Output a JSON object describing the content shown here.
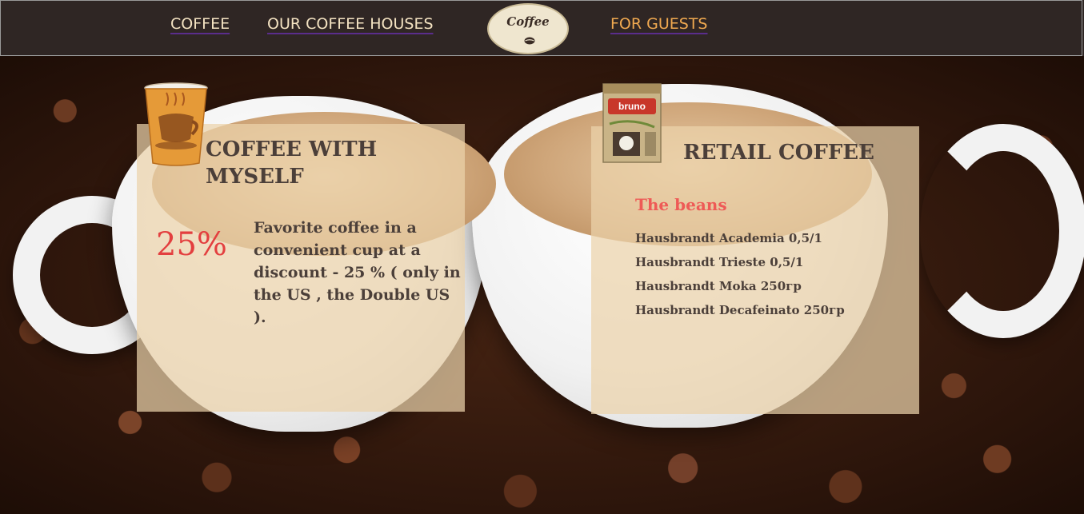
{
  "nav": {
    "coffee": "COFFEE",
    "coffee_houses": "OUR COFFEE HOUSES",
    "for_guests": "FOR GUESTS",
    "logo_text": "Coffee"
  },
  "promo": {
    "title": "COFFEE WITH MYSELF",
    "discount": "25%",
    "description": "Favorite coffee in a convenient cup at a discount - 25 % ( only in the US , the Double US )."
  },
  "retail": {
    "title": "RETAIL COFFEE",
    "brand_label": "bruno",
    "beans_heading": "The beans",
    "products": [
      "Hausbrandt Academia 0,5/1",
      "Hausbrandt Trieste 0,5/1",
      "Hausbrandt Moka 250гр",
      "Hausbrandt Decafeinato 250гр"
    ]
  },
  "colors": {
    "navbar_bg": "#2f2624",
    "nav_link": "#f4e3c2",
    "nav_link_active": "#f0a950",
    "panel_bg": "rgba(236,210,170,0.72)",
    "accent_red": "#e33f3f",
    "heading_text": "#4b3f39"
  },
  "icons": {
    "logo": "coffee-bean-logo",
    "promo_image": "paper-coffee-cup",
    "retail_image": "coffee-package"
  }
}
